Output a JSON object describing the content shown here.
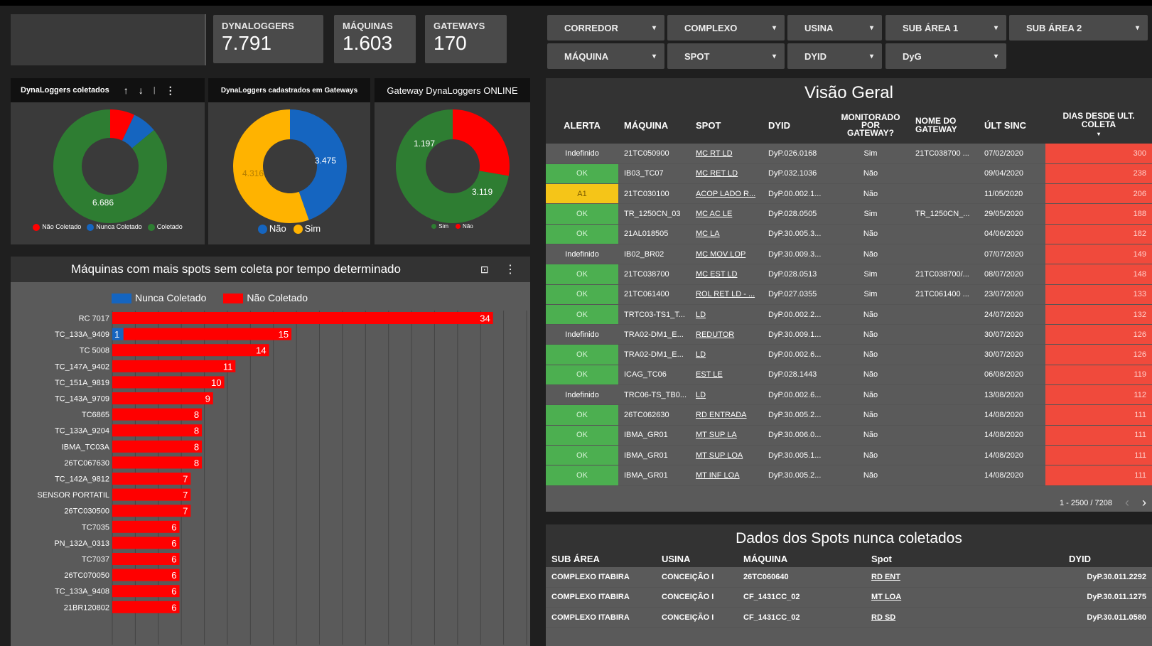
{
  "kpis": [
    {
      "label": "DYNALOGGERS",
      "value": "7.791"
    },
    {
      "label": "MÁQUINAS",
      "value": "1.603"
    },
    {
      "label": "GATEWAYS",
      "value": "170"
    }
  ],
  "filters": {
    "row1": [
      "CORREDOR",
      "COMPLEXO",
      "USINA",
      "SUB ÁREA 1",
      "SUB ÁREA 2"
    ],
    "row2": [
      "MÁQUINA",
      "SPOT",
      "DYID",
      "DyG"
    ]
  },
  "donut1": {
    "title": "DynaLoggers coletados",
    "center_label": "6.686",
    "legend": [
      "Não Coletado",
      "Nunca Coletado",
      "Coletado"
    ],
    "values": [
      0.07,
      0.07,
      0.86
    ],
    "colors": [
      "#ff0000",
      "#1565c0",
      "#2e7d32"
    ]
  },
  "donut2": {
    "title": "DynaLoggers cadastrados em Gateways",
    "labels": [
      "3.475",
      "4.316"
    ],
    "legend": [
      "Não",
      "Sim"
    ],
    "values": [
      0.446,
      0.554
    ],
    "colors": [
      "#1565c0",
      "#ffb300"
    ]
  },
  "donut3": {
    "title": "Gateway DynaLoggers ONLINE",
    "labels": [
      "1.197",
      "3.119"
    ],
    "legend": [
      "Sim",
      "Não"
    ],
    "values": [
      0.277,
      0.723
    ],
    "colors": [
      "#ff0000",
      "#2e7d32"
    ]
  },
  "barchart": {
    "title": "Máquinas com mais spots sem coleta por tempo determinado",
    "legend": [
      "Nunca Coletado",
      "Não Coletado"
    ],
    "colors": {
      "nunca": "#1565c0",
      "nao": "#ff0000"
    }
  },
  "chart_data": {
    "type": "bar",
    "categories": [
      "RC 7017",
      "TC_133A_9409",
      "TC 5008",
      "TC_147A_9402",
      "TC_151A_9819",
      "TC_143A_9709",
      "TC6865",
      "TC_133A_9204",
      "IBMA_TC03A",
      "26TC067630",
      "TC_142A_9812",
      "SENSOR PORTATIL",
      "26TC030500",
      "TC7035",
      "PN_132A_0313",
      "TC7037",
      "26TC070050",
      "TC_133A_9408",
      "21BR120802"
    ],
    "series": [
      {
        "name": "Nunca Coletado",
        "values": [
          0,
          1,
          0,
          0,
          0,
          0,
          0,
          0,
          0,
          0,
          0,
          0,
          0,
          0,
          0,
          0,
          0,
          0,
          0
        ]
      },
      {
        "name": "Não Coletado",
        "values": [
          34,
          15,
          14,
          11,
          10,
          9,
          8,
          8,
          8,
          8,
          7,
          7,
          7,
          6,
          6,
          6,
          6,
          6,
          6
        ]
      }
    ],
    "xlim": [
      0,
      37
    ]
  },
  "visao": {
    "title": "Visão Geral",
    "headers": [
      "ALERTA",
      "MÁQUINA",
      "SPOT",
      "DYID",
      "MONITORADO POR GATEWAY?",
      "NOME DO GATEWAY",
      "ÚLT SINC",
      "DIAS DESDE ULT. COLETA"
    ],
    "rows": [
      [
        "Indefinido",
        "21TC050900",
        "MC RT LD",
        "DyP.026.0168",
        "Sim",
        "21TC038700 ...",
        "07/02/2020",
        "300"
      ],
      [
        "OK",
        "IB03_TC07",
        "MC RET LD",
        "DyP.032.1036",
        "Não",
        "",
        "09/04/2020",
        "238"
      ],
      [
        "A1",
        "21TC030100",
        "ACOP LADO R...",
        "DyP.00.002.1...",
        "Não",
        "",
        "11/05/2020",
        "206"
      ],
      [
        "OK",
        "TR_1250CN_03",
        "MC AC LE",
        "DyP.028.0505",
        "Sim",
        "TR_1250CN_...",
        "29/05/2020",
        "188"
      ],
      [
        "OK",
        "21AL018505",
        "MC LA",
        "DyP.30.005.3...",
        "Não",
        "",
        "04/06/2020",
        "182"
      ],
      [
        "Indefinido",
        "IB02_BR02",
        "MC MOV LOP",
        "DyP.30.009.3...",
        "Não",
        "",
        "07/07/2020",
        "149"
      ],
      [
        "OK",
        "21TC038700",
        "MC EST LD",
        "DyP.028.0513",
        "Sim",
        "21TC038700/...",
        "08/07/2020",
        "148"
      ],
      [
        "OK",
        "21TC061400",
        "ROL RET LD - ...",
        "DyP.027.0355",
        "Sim",
        "21TC061400 ...",
        "23/07/2020",
        "133"
      ],
      [
        "OK",
        "TRTC03-TS1_T...",
        "LD",
        "DyP.00.002.2...",
        "Não",
        "",
        "24/07/2020",
        "132"
      ],
      [
        "Indefinido",
        "TRA02-DM1_E...",
        "REDUTOR",
        "DyP.30.009.1...",
        "Não",
        "",
        "30/07/2020",
        "126"
      ],
      [
        "OK",
        "TRA02-DM1_E...",
        "LD",
        "DyP.00.002.6...",
        "Não",
        "",
        "30/07/2020",
        "126"
      ],
      [
        "OK",
        "ICAG_TC06",
        "EST LE",
        "DyP.028.1443",
        "Não",
        "",
        "06/08/2020",
        "119"
      ],
      [
        "Indefinido",
        "TRC06-TS_TB0...",
        "LD",
        "DyP.00.002.6...",
        "Não",
        "",
        "13/08/2020",
        "112"
      ],
      [
        "OK",
        "26TC062630",
        "RD ENTRADA",
        "DyP.30.005.2...",
        "Não",
        "",
        "14/08/2020",
        "111"
      ],
      [
        "OK",
        "IBMA_GR01",
        "MT SUP LA",
        "DyP.30.006.0...",
        "Não",
        "",
        "14/08/2020",
        "111"
      ],
      [
        "OK",
        "IBMA_GR01",
        "MT SUP LOA",
        "DyP.30.005.1...",
        "Não",
        "",
        "14/08/2020",
        "111"
      ],
      [
        "OK",
        "IBMA_GR01",
        "MT INF LOA",
        "DyP.30.005.2...",
        "Não",
        "",
        "14/08/2020",
        "111"
      ]
    ],
    "pagination": "1 - 2500 / 7208"
  },
  "nunca": {
    "title": "Dados dos Spots nunca coletados",
    "headers": [
      "SUB ÁREA",
      "USINA",
      "MÁQUINA",
      "Spot",
      "DYID"
    ],
    "rows": [
      [
        "COMPLEXO ITABIRA",
        "CONCEIÇÃO I",
        "26TC060640",
        "RD ENT",
        "DyP.30.011.2292"
      ],
      [
        "COMPLEXO ITABIRA",
        "CONCEIÇÃO I",
        "CF_1431CC_02",
        "MT LOA",
        "DyP.30.011.1275"
      ],
      [
        "COMPLEXO ITABIRA",
        "CONCEIÇÃO I",
        "CF_1431CC_02",
        "RD SD",
        "DyP.30.011.0580"
      ]
    ]
  }
}
